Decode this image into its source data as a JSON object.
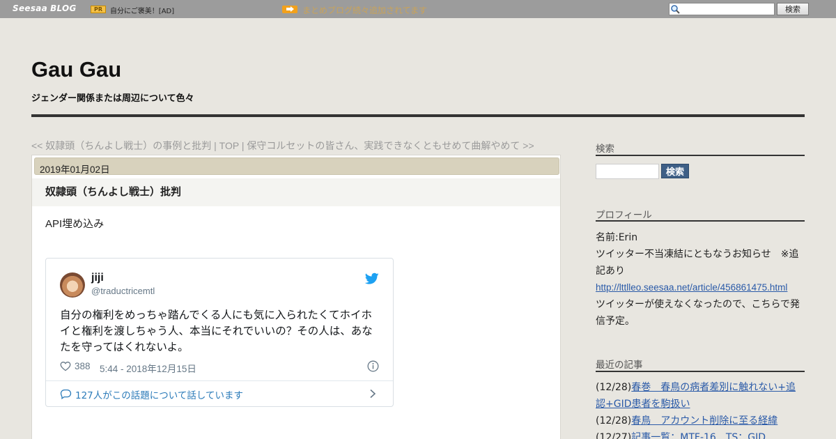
{
  "topbar": {
    "logo_brand": "Seesaa",
    "logo_blog": "BLOG",
    "pr_badge": "PR",
    "pr_text": "自分にご褒美！[AD]",
    "news_text": "まとめブログ続々追加されてます",
    "search_button": "検索"
  },
  "header": {
    "title": "Gau Gau",
    "subtitle": "ジェンダー関係または周辺について色々"
  },
  "nav": {
    "prev": "<< 奴隷頭（ちんよし戦士）の事例と批判",
    "sep1": " | ",
    "top": "TOP",
    "sep2": " | ",
    "next": "保守コルセットの皆さん、実践できなくともせめて曲解やめて >>"
  },
  "post": {
    "date": "2019年01月02日",
    "title": "奴隷頭（ちんよし戦士）批判",
    "body": "API埋め込み",
    "tweet": {
      "name": "jiji",
      "handle": "@traductricemtl",
      "text": "自分の権利をめっちゃ踏んでくる人にも気に入られたくてホイホイと権利を渡しちゃう人、本当にそれでいいの？その人は、あなたを守ってはくれないよ。",
      "likes": "388",
      "time": "5:44 - 2018年12月15日",
      "reply_text": "127人がこの話題について話しています"
    }
  },
  "sidebar": {
    "search_heading": "検索",
    "search_button": "検索",
    "profile_heading": "プロフィール",
    "profile_name": "名前:Erin",
    "profile_notice": "ツイッター不当凍結にともなうお知らせ　※追記あり",
    "profile_link": "http://lttlleo.seesaa.net/article/456861475.html",
    "profile_note": "ツイッターが使えなくなったので、こちらで発信予定。",
    "recent_heading": "最近の記事",
    "recent": [
      {
        "date": "(12/28)",
        "title": "春巻　春鳥の病者差別に触れない+追認+GID患者を駒扱い"
      },
      {
        "date": "(12/28)",
        "title": "春鳥　アカウント削除に至る経緯"
      },
      {
        "date": "(12/27)",
        "title": "記事一覧：MTF-16　TS：GID"
      }
    ]
  },
  "colors": {
    "topbar_bg": "#9c9c9c",
    "page_bg": "#e8e6e0",
    "date_bar_bg": "#d8d2bd",
    "link": "#2a5aa8",
    "twitter_blue": "#1da1f2",
    "side_search_button": "#3e5f86"
  },
  "icons": [
    "search-icon",
    "twitter-bird-icon",
    "heart-icon",
    "info-icon",
    "reply-icon",
    "chevron-right-icon",
    "arrow-icon"
  ]
}
